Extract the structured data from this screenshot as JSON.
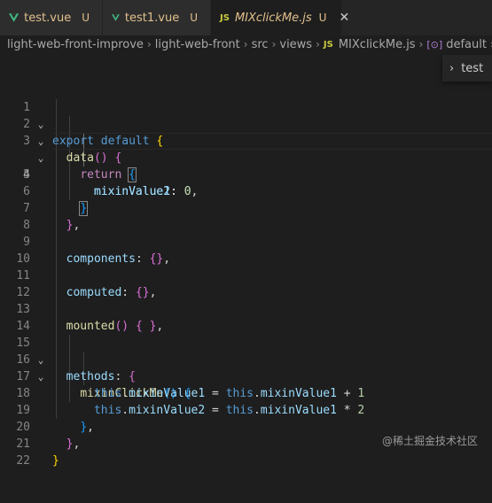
{
  "tabs": [
    {
      "name": "test.vue",
      "status": "U",
      "icon": "vue-icon",
      "active": false
    },
    {
      "name": "test1.vue",
      "status": "U",
      "icon": "vue-icon",
      "active": false
    },
    {
      "name": "MIXclickMe.js",
      "status": "U",
      "icon": "js-icon",
      "icon_text": "JS",
      "active": true
    }
  ],
  "breadcrumb": {
    "items": [
      "light-web-front-improve",
      "light-web-front",
      "src",
      "views",
      "MIXclickMe.js",
      "default"
    ],
    "js_badge": "JS"
  },
  "sticky_scroll": {
    "label": "test"
  },
  "editor": {
    "current_line": 4,
    "lines": [
      {
        "num": "1"
      },
      {
        "num": "2"
      },
      {
        "num": "3"
      },
      {
        "num": "4"
      },
      {
        "num": "5"
      },
      {
        "num": "6"
      },
      {
        "num": "7"
      },
      {
        "num": "8"
      },
      {
        "num": "9"
      },
      {
        "num": "10"
      },
      {
        "num": "11"
      },
      {
        "num": "12"
      },
      {
        "num": "13"
      },
      {
        "num": "14"
      },
      {
        "num": "15"
      },
      {
        "num": "16"
      },
      {
        "num": "17"
      },
      {
        "num": "18"
      },
      {
        "num": "19"
      },
      {
        "num": "20"
      },
      {
        "num": "21"
      },
      {
        "num": "22"
      }
    ],
    "tokens": {
      "export": "export",
      "default": "default",
      "data": "data",
      "return": "return",
      "mixinValue1": "mixinValue1",
      "mixinValue2": "mixinValue2",
      "zero": "0",
      "components": "components",
      "computed": "computed",
      "mounted": "mounted",
      "methods": "methods",
      "mixinClickMe": "mixinClickMe",
      "this": "this",
      "one": "1",
      "two": "2"
    }
  },
  "watermark": "@稀土掘金技术社区",
  "colors": {
    "background": "#1e1e1e",
    "keyword": "#569cd6",
    "control": "#c586c0",
    "function": "#dcdcaa",
    "property": "#9cdcfe",
    "number": "#b5cea8"
  }
}
